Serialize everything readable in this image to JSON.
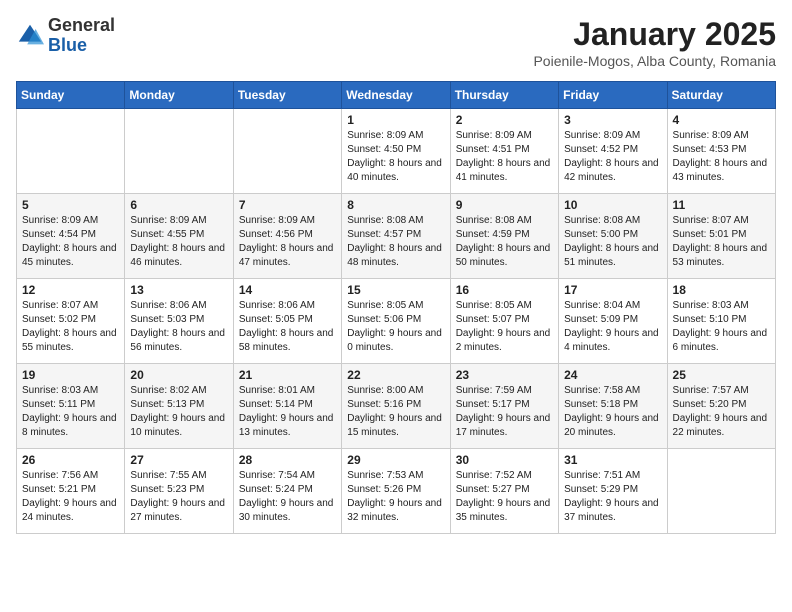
{
  "logo": {
    "general": "General",
    "blue": "Blue"
  },
  "header": {
    "title": "January 2025",
    "subtitle": "Poienile-Mogos, Alba County, Romania"
  },
  "weekdays": [
    "Sunday",
    "Monday",
    "Tuesday",
    "Wednesday",
    "Thursday",
    "Friday",
    "Saturday"
  ],
  "weeks": [
    [
      {
        "day": "",
        "sunrise": "",
        "sunset": "",
        "daylight": ""
      },
      {
        "day": "",
        "sunrise": "",
        "sunset": "",
        "daylight": ""
      },
      {
        "day": "",
        "sunrise": "",
        "sunset": "",
        "daylight": ""
      },
      {
        "day": "1",
        "sunrise": "Sunrise: 8:09 AM",
        "sunset": "Sunset: 4:50 PM",
        "daylight": "Daylight: 8 hours and 40 minutes."
      },
      {
        "day": "2",
        "sunrise": "Sunrise: 8:09 AM",
        "sunset": "Sunset: 4:51 PM",
        "daylight": "Daylight: 8 hours and 41 minutes."
      },
      {
        "day": "3",
        "sunrise": "Sunrise: 8:09 AM",
        "sunset": "Sunset: 4:52 PM",
        "daylight": "Daylight: 8 hours and 42 minutes."
      },
      {
        "day": "4",
        "sunrise": "Sunrise: 8:09 AM",
        "sunset": "Sunset: 4:53 PM",
        "daylight": "Daylight: 8 hours and 43 minutes."
      }
    ],
    [
      {
        "day": "5",
        "sunrise": "Sunrise: 8:09 AM",
        "sunset": "Sunset: 4:54 PM",
        "daylight": "Daylight: 8 hours and 45 minutes."
      },
      {
        "day": "6",
        "sunrise": "Sunrise: 8:09 AM",
        "sunset": "Sunset: 4:55 PM",
        "daylight": "Daylight: 8 hours and 46 minutes."
      },
      {
        "day": "7",
        "sunrise": "Sunrise: 8:09 AM",
        "sunset": "Sunset: 4:56 PM",
        "daylight": "Daylight: 8 hours and 47 minutes."
      },
      {
        "day": "8",
        "sunrise": "Sunrise: 8:08 AM",
        "sunset": "Sunset: 4:57 PM",
        "daylight": "Daylight: 8 hours and 48 minutes."
      },
      {
        "day": "9",
        "sunrise": "Sunrise: 8:08 AM",
        "sunset": "Sunset: 4:59 PM",
        "daylight": "Daylight: 8 hours and 50 minutes."
      },
      {
        "day": "10",
        "sunrise": "Sunrise: 8:08 AM",
        "sunset": "Sunset: 5:00 PM",
        "daylight": "Daylight: 8 hours and 51 minutes."
      },
      {
        "day": "11",
        "sunrise": "Sunrise: 8:07 AM",
        "sunset": "Sunset: 5:01 PM",
        "daylight": "Daylight: 8 hours and 53 minutes."
      }
    ],
    [
      {
        "day": "12",
        "sunrise": "Sunrise: 8:07 AM",
        "sunset": "Sunset: 5:02 PM",
        "daylight": "Daylight: 8 hours and 55 minutes."
      },
      {
        "day": "13",
        "sunrise": "Sunrise: 8:06 AM",
        "sunset": "Sunset: 5:03 PM",
        "daylight": "Daylight: 8 hours and 56 minutes."
      },
      {
        "day": "14",
        "sunrise": "Sunrise: 8:06 AM",
        "sunset": "Sunset: 5:05 PM",
        "daylight": "Daylight: 8 hours and 58 minutes."
      },
      {
        "day": "15",
        "sunrise": "Sunrise: 8:05 AM",
        "sunset": "Sunset: 5:06 PM",
        "daylight": "Daylight: 9 hours and 0 minutes."
      },
      {
        "day": "16",
        "sunrise": "Sunrise: 8:05 AM",
        "sunset": "Sunset: 5:07 PM",
        "daylight": "Daylight: 9 hours and 2 minutes."
      },
      {
        "day": "17",
        "sunrise": "Sunrise: 8:04 AM",
        "sunset": "Sunset: 5:09 PM",
        "daylight": "Daylight: 9 hours and 4 minutes."
      },
      {
        "day": "18",
        "sunrise": "Sunrise: 8:03 AM",
        "sunset": "Sunset: 5:10 PM",
        "daylight": "Daylight: 9 hours and 6 minutes."
      }
    ],
    [
      {
        "day": "19",
        "sunrise": "Sunrise: 8:03 AM",
        "sunset": "Sunset: 5:11 PM",
        "daylight": "Daylight: 9 hours and 8 minutes."
      },
      {
        "day": "20",
        "sunrise": "Sunrise: 8:02 AM",
        "sunset": "Sunset: 5:13 PM",
        "daylight": "Daylight: 9 hours and 10 minutes."
      },
      {
        "day": "21",
        "sunrise": "Sunrise: 8:01 AM",
        "sunset": "Sunset: 5:14 PM",
        "daylight": "Daylight: 9 hours and 13 minutes."
      },
      {
        "day": "22",
        "sunrise": "Sunrise: 8:00 AM",
        "sunset": "Sunset: 5:16 PM",
        "daylight": "Daylight: 9 hours and 15 minutes."
      },
      {
        "day": "23",
        "sunrise": "Sunrise: 7:59 AM",
        "sunset": "Sunset: 5:17 PM",
        "daylight": "Daylight: 9 hours and 17 minutes."
      },
      {
        "day": "24",
        "sunrise": "Sunrise: 7:58 AM",
        "sunset": "Sunset: 5:18 PM",
        "daylight": "Daylight: 9 hours and 20 minutes."
      },
      {
        "day": "25",
        "sunrise": "Sunrise: 7:57 AM",
        "sunset": "Sunset: 5:20 PM",
        "daylight": "Daylight: 9 hours and 22 minutes."
      }
    ],
    [
      {
        "day": "26",
        "sunrise": "Sunrise: 7:56 AM",
        "sunset": "Sunset: 5:21 PM",
        "daylight": "Daylight: 9 hours and 24 minutes."
      },
      {
        "day": "27",
        "sunrise": "Sunrise: 7:55 AM",
        "sunset": "Sunset: 5:23 PM",
        "daylight": "Daylight: 9 hours and 27 minutes."
      },
      {
        "day": "28",
        "sunrise": "Sunrise: 7:54 AM",
        "sunset": "Sunset: 5:24 PM",
        "daylight": "Daylight: 9 hours and 30 minutes."
      },
      {
        "day": "29",
        "sunrise": "Sunrise: 7:53 AM",
        "sunset": "Sunset: 5:26 PM",
        "daylight": "Daylight: 9 hours and 32 minutes."
      },
      {
        "day": "30",
        "sunrise": "Sunrise: 7:52 AM",
        "sunset": "Sunset: 5:27 PM",
        "daylight": "Daylight: 9 hours and 35 minutes."
      },
      {
        "day": "31",
        "sunrise": "Sunrise: 7:51 AM",
        "sunset": "Sunset: 5:29 PM",
        "daylight": "Daylight: 9 hours and 37 minutes."
      },
      {
        "day": "",
        "sunrise": "",
        "sunset": "",
        "daylight": ""
      }
    ]
  ]
}
